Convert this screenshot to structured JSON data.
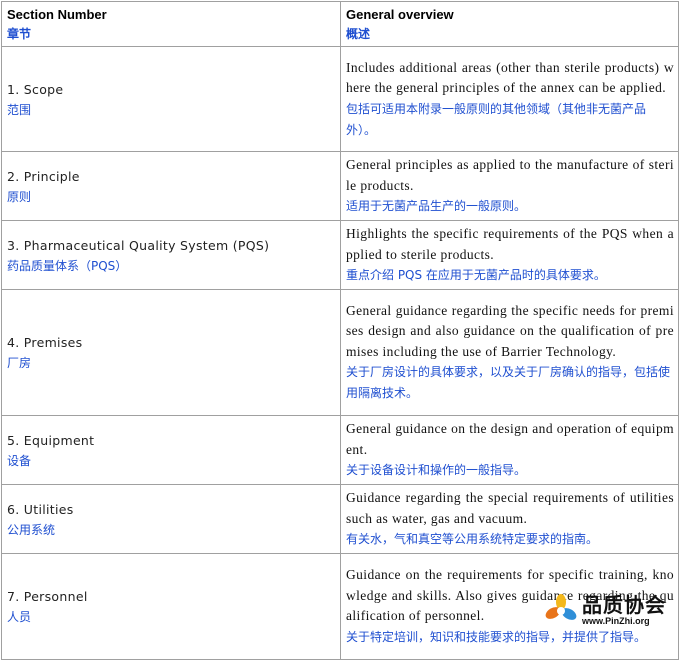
{
  "header": {
    "col1_en": "Section Number",
    "col1_zh": "章节",
    "col2_en": "General  overview",
    "col2_zh": "概述"
  },
  "rows": [
    {
      "section_en": "1.  Scope",
      "section_zh": "范围",
      "overview_en": "Includes additional areas (other than sterile products) where the general principles of the annex can be applied.",
      "overview_zh": "包括可适用本附录一般原则的其他领域（其他非无菌产品外）。"
    },
    {
      "section_en": "2.  Principle",
      "section_zh": "原则",
      "overview_en": "General principles as applied to the manufacture of sterile products.",
      "overview_zh": "适用于无菌产品生产的一般原则。"
    },
    {
      "section_en": "3.  Pharmaceutical  Quality System  (PQS)",
      "section_zh": "药品质量体系（PQS）",
      "overview_en": "Highlights the specific requirements of the PQS when applied to sterile products.",
      "overview_zh": "重点介绍 PQS 在应用于无菌产品时的具体要求。"
    },
    {
      "section_en": "4.  Premises",
      "section_zh": "厂房",
      "overview_en": "General guidance regarding the specific needs for premises design and also guidance on the qualification of premises including the use of Barrier Technology.",
      "overview_zh": "关于厂房设计的具体要求，以及关于厂房确认的指导，包括使用隔离技术。"
    },
    {
      "section_en": "5.  Equipment",
      "section_zh": "设备",
      "overview_en": "General guidance on the design and operation of equipment.",
      "overview_zh": "关于设备设计和操作的一般指导。"
    },
    {
      "section_en": "6.  Utilities",
      "section_zh": "公用系统",
      "overview_en": "Guidance regarding the special requirements of utilities such as water, gas and vacuum.",
      "overview_zh": "有关水，气和真空等公用系统特定要求的指南。"
    },
    {
      "section_en": "7.  Personnel",
      "section_zh": "人员",
      "overview_en": "Guidance on the requirements for specific training, knowledge and skills. Also gives guidance regarding the qualification of personnel.",
      "overview_zh": "关于特定培训，知识和技能要求的指导，并提供了指导。"
    }
  ],
  "watermark": {
    "name": "品质协会",
    "url": "www.PinZhi.org",
    "colors": {
      "petal_yellow": "#f3b81c",
      "petal_orange": "#e8741a",
      "petal_blue": "#2f8fd8"
    }
  }
}
